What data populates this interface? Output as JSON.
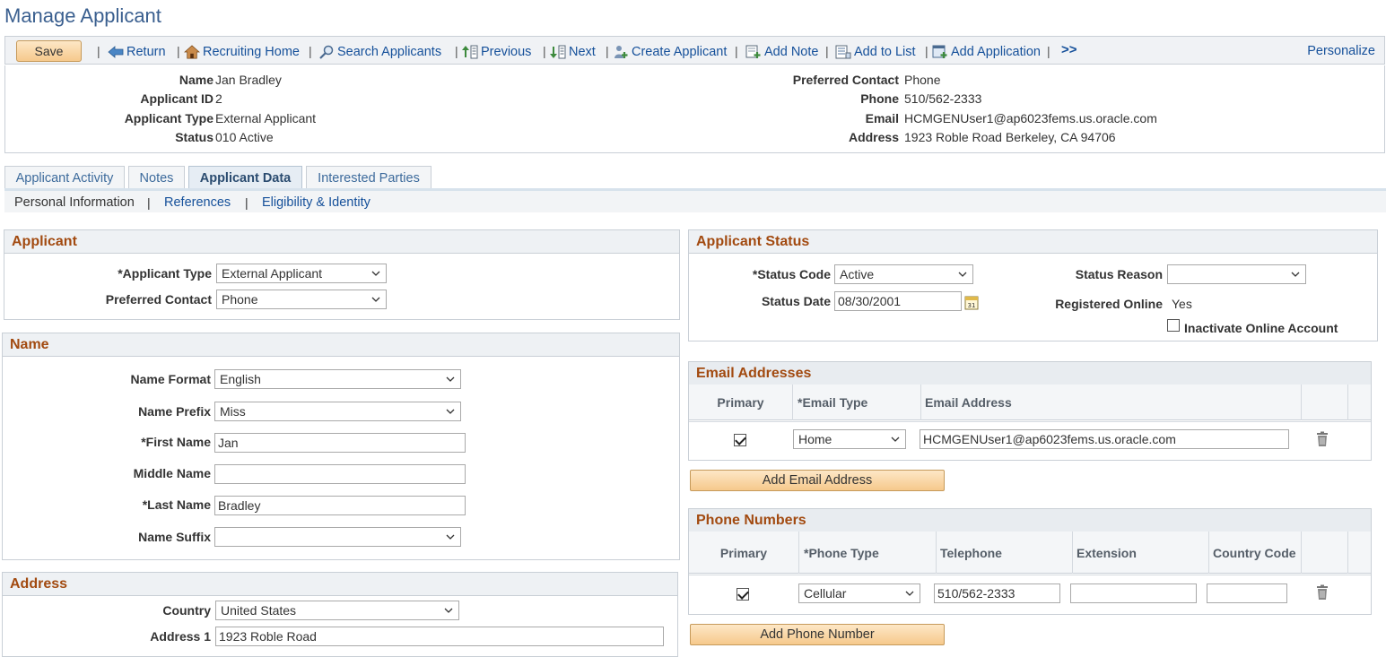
{
  "page": {
    "title": "Manage Applicant"
  },
  "toolbar": {
    "save": "Save",
    "links": [
      {
        "label": "Return",
        "icon": "return-icon"
      },
      {
        "label": "Recruiting Home",
        "icon": "home-icon"
      },
      {
        "label": "Search Applicants",
        "icon": "search-applicants-icon"
      },
      {
        "label": "Previous",
        "icon": "previous-icon"
      },
      {
        "label": "Next",
        "icon": "next-icon"
      },
      {
        "label": "Create Applicant",
        "icon": "create-applicant-icon"
      },
      {
        "label": "Add Note",
        "icon": "add-note-icon"
      },
      {
        "label": "Add to List",
        "icon": "add-to-list-icon"
      },
      {
        "label": "Add Application",
        "icon": "add-application-icon"
      }
    ],
    "more": ">>",
    "personalize": "Personalize"
  },
  "header": {
    "left": [
      {
        "label": "Name",
        "value": "Jan Bradley"
      },
      {
        "label": "Applicant ID",
        "value": "2"
      },
      {
        "label": "Applicant Type",
        "value": "External Applicant"
      },
      {
        "label": "Status",
        "value": "010 Active"
      }
    ],
    "right": [
      {
        "label": "Preferred Contact",
        "value": "Phone"
      },
      {
        "label": "Phone",
        "value": "510/562-2333"
      },
      {
        "label": "Email",
        "value": "HCMGENUser1@ap6023fems.us.oracle.com"
      },
      {
        "label": "Address",
        "value": "1923 Roble Road Berkeley, CA 94706"
      }
    ]
  },
  "tabs": [
    {
      "label": "Applicant Activity"
    },
    {
      "label": "Notes"
    },
    {
      "label": "Applicant Data",
      "active": true
    },
    {
      "label": "Interested Parties"
    }
  ],
  "subnav": {
    "current": "Personal Information",
    "references": "References",
    "eligibility": "Eligibility & Identity",
    "sep": "|"
  },
  "applicant": {
    "title": "Applicant",
    "type_label": "*Applicant Type",
    "type_value": "External Applicant",
    "contact_label": "Preferred Contact",
    "contact_value": "Phone"
  },
  "name_section": {
    "title": "Name",
    "format_label": "Name Format",
    "format_value": "English",
    "prefix_label": "Name Prefix",
    "prefix_value": "Miss",
    "first_label": "*First Name",
    "first_value": "Jan",
    "middle_label": "Middle Name",
    "middle_value": "",
    "last_label": "*Last Name",
    "last_value": "Bradley",
    "suffix_label": "Name Suffix",
    "suffix_value": ""
  },
  "address_section": {
    "title": "Address",
    "country_label": "Country",
    "country_value": "United States",
    "address1_label": "Address 1",
    "address1_value": "1923 Roble Road"
  },
  "status_section": {
    "title": "Applicant Status",
    "code_label": "*Status Code",
    "code_value": "Active",
    "date_label": "Status Date",
    "date_value": "08/30/2001",
    "reason_label": "Status Reason",
    "reason_value": "",
    "registered_label": "Registered Online",
    "registered_value": "Yes",
    "inactivate_label": "Inactivate Online Account"
  },
  "email_section": {
    "title": "Email Addresses",
    "col_primary": "Primary",
    "col_type": "*Email Type",
    "col_address": "Email Address",
    "row_type": "Home",
    "row_address": "HCMGENUser1@ap6023fems.us.oracle.com",
    "add_button": "Add Email Address"
  },
  "phone_section": {
    "title": "Phone Numbers",
    "col_primary": "Primary",
    "col_type": "*Phone Type",
    "col_telephone": "Telephone",
    "col_extension": "Extension",
    "col_country": "Country Code",
    "row_type": "Cellular",
    "row_telephone": "510/562-2333",
    "row_extension": "",
    "row_country": "",
    "add_button": "Add Phone Number"
  }
}
